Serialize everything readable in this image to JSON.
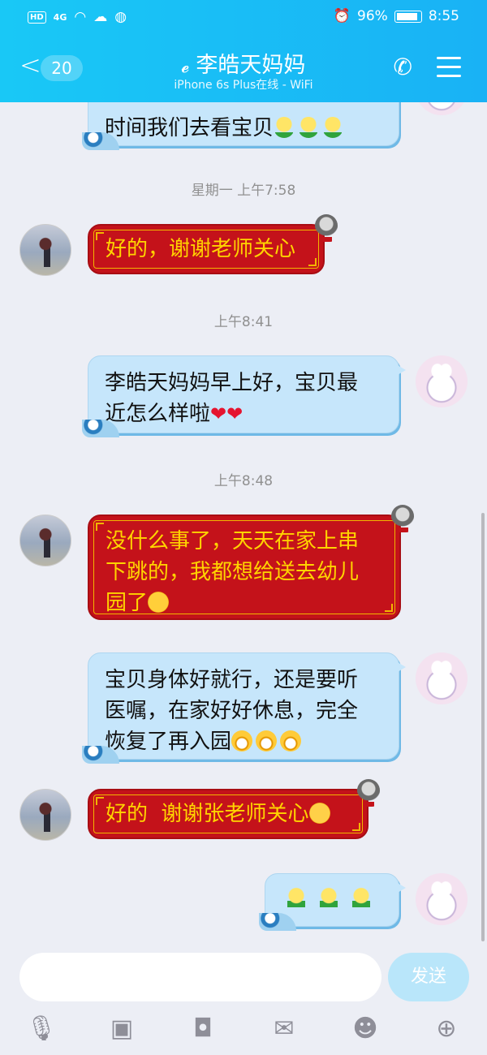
{
  "status_bar": {
    "hd": "HD",
    "signal": "4G",
    "battery": "96%",
    "time": "8:55"
  },
  "header": {
    "back_count": "20",
    "title": "李皓天妈妈",
    "subtitle": "iPhone 6s Plus在线 - WiFi"
  },
  "chat": {
    "msg0": {
      "text": "时间我们去看宝贝"
    },
    "ts1": "星期一 上午7:58",
    "msg1": {
      "text": "好的，谢谢老师关心"
    },
    "ts2": "上午8:41",
    "msg2": {
      "text1": "李皓天妈妈早上好，宝贝最",
      "text2": "近怎么样啦"
    },
    "ts3": "上午8:48",
    "msg3": {
      "text1": "没什么事了，天天在家上串",
      "text2": "下跳的，我都想给送去幼儿",
      "text3": "园了"
    },
    "msg4": {
      "text1": "宝贝身体好就行，还是要听",
      "text2": "医嘱，在家好好休息，完全",
      "text3": "恢复了再入园"
    },
    "msg5": {
      "text": "好的  谢谢张老师关心"
    }
  },
  "input": {
    "placeholder": "",
    "send_label": "发送"
  },
  "icons": {
    "back": "chevron-left-icon",
    "ear": "ear-icon",
    "phone": "phone-icon",
    "menu": "hamburger-menu-icon",
    "mic": "microphone-icon",
    "image": "image-icon",
    "camera": "camera-icon",
    "redpacket": "red-packet-icon",
    "emoji": "emoji-icon",
    "plus": "plus-icon"
  },
  "colors": {
    "header": "#19c8f6",
    "red_bubble": "#c4121a",
    "gold_text": "#ffd400",
    "blue_bubble": "#c6e6fb"
  }
}
